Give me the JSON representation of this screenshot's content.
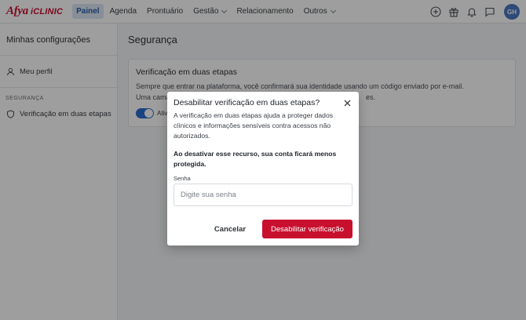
{
  "brand": {
    "afya": "Afya",
    "iclinic": "iCLINIC",
    "color": "#c8102e"
  },
  "nav": {
    "items": [
      {
        "label": "Painel",
        "active": true
      },
      {
        "label": "Agenda"
      },
      {
        "label": "Prontuário"
      },
      {
        "label": "Gestão",
        "dropdown": true
      },
      {
        "label": "Relacionamento"
      },
      {
        "label": "Outros",
        "dropdown": true
      }
    ]
  },
  "top_icons": [
    "plus-circle-icon",
    "gift-icon",
    "bell-icon",
    "chat-icon"
  ],
  "user": {
    "initials": "GH"
  },
  "sidebar": {
    "title": "Minhas configurações",
    "profile_item": "Meu perfil",
    "section_label": "SEGURANÇA",
    "security_item": "Verificação em duas etapas"
  },
  "main": {
    "title": "Segurança",
    "card": {
      "title": "Verificação em duas etapas",
      "desc_line1": "Sempre que entrar na plataforma, você confirmará sua identidade usando um código enviado por e-mail.",
      "desc_line2": "Uma cama",
      "desc_line2_end": "es.",
      "toggle_label": "Ativ",
      "toggle_on": true
    }
  },
  "modal": {
    "title": "Desabilitar verificação em duas etapas?",
    "text": "A verificação em duas etapas ajuda a proteger dados clínicos e informações sensíveis contra acessos não autorizados.",
    "warning": "Ao desativar esse recurso, sua conta ficará menos protegida.",
    "password_label": "Senha",
    "password_placeholder": "Digite sua senha",
    "password_value": "",
    "cancel_label": "Cancelar",
    "confirm_label": "Desabilitar verificação"
  },
  "colors": {
    "accent": "#2b6fd1",
    "danger": "#c8102e",
    "nav_active_bg": "#dde7f6"
  }
}
